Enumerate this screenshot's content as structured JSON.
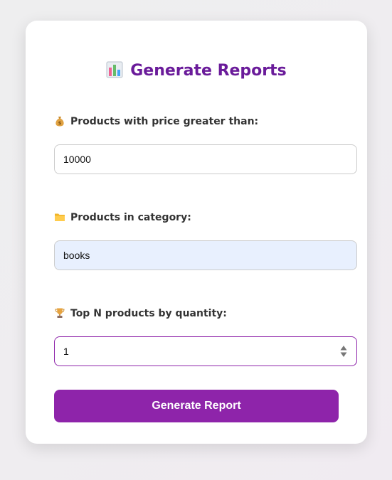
{
  "form": {
    "title": "Generate Reports",
    "title_icon": "bar-chart-icon",
    "price_label": "Products with price greater than:",
    "price_icon": "money-bag-icon",
    "price_value": "10000",
    "category_label": "Products in category:",
    "category_icon": "folder-icon",
    "category_value": "books",
    "topn_label": "Top N products by quantity:",
    "topn_icon": "trophy-icon",
    "topn_value": "1",
    "submit_label": "Generate Report"
  },
  "colors": {
    "accent": "#8e24aa",
    "title": "#6a1b9a",
    "autofill_bg": "#e8f0fe"
  }
}
